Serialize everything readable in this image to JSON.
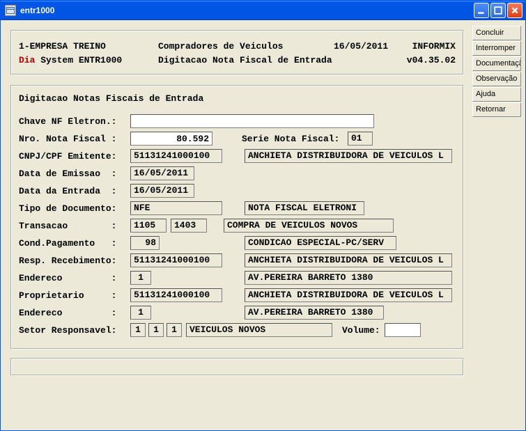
{
  "window": {
    "title": "entr1000"
  },
  "titlebar_buttons": {
    "min": "–",
    "max": "□",
    "close": "×"
  },
  "sidebar": {
    "concluir": "Concluir",
    "interromper": "Interromper",
    "documentacao": "Documentação",
    "observacao": "Observação",
    "ajuda": "Ajuda",
    "retornar": "Retornar"
  },
  "header": {
    "line1_left": "1-EMPRESA TREINO",
    "line1_center": "Compradores de Veiculos",
    "line1_date": "16/05/2011",
    "line1_right": "INFORMIX",
    "line2_prefix": "Dia",
    "line2_rest": " System  ENTR1000",
    "line2_center": "Digitacao Nota Fiscal de Entrada",
    "line2_right": "v04.35.02"
  },
  "form": {
    "title": "Digitacao Notas Fiscais de Entrada",
    "labels": {
      "chave": "Chave NF Eletron.:",
      "nro": "Nro. Nota Fiscal :",
      "serie": "Serie Nota Fiscal:",
      "cnpj": "CNPJ/CPF Emitente:",
      "emissao": "Data de Emissao  :",
      "entrada": "Data da Entrada  :",
      "tipo": "Tipo de Documento:",
      "transacao": "Transacao        :",
      "cond": "Cond.Pagamento   :",
      "resp": "Resp. Recebimento:",
      "endereco": "Endereco         :",
      "proprietario": "Proprietario     :",
      "setor": "Setor Responsavel:",
      "volume": "Volume:"
    },
    "values": {
      "chave": "",
      "nro": "80.592",
      "serie": "01",
      "cnpj": "51131241000100",
      "cnpj_nome": "ANCHIETA DISTRIBUIDORA DE VEICULOS L",
      "emissao": "16/05/2011",
      "entrada": "16/05/2011",
      "tipo": "NFE",
      "tipo_desc": "NOTA FISCAL ELETRONI",
      "transacao1": "1105",
      "transacao2": "1403",
      "transacao_desc": "COMPRA DE VEICULOS NOVOS",
      "cond": "98",
      "cond_desc": "CONDICAO ESPECIAL-PC/SERV",
      "resp": "51131241000100",
      "resp_nome": "ANCHIETA DISTRIBUIDORA DE VEICULOS L",
      "resp_end_num": "1",
      "resp_end": "AV.PEREIRA BARRETO 1380",
      "prop": "51131241000100",
      "prop_nome": "ANCHIETA DISTRIBUIDORA DE VEICULOS L",
      "prop_end_num": "1",
      "prop_end": "AV.PEREIRA BARRETO 1380",
      "setor1": "1",
      "setor2": "1",
      "setor3": "1",
      "setor_desc": "VEICULOS NOVOS",
      "volume": ""
    }
  }
}
